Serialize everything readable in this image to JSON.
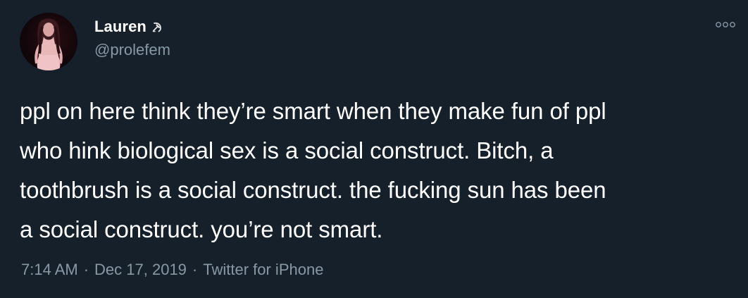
{
  "tweet": {
    "display_name": "Lauren",
    "handle": "@prolefem",
    "text": "ppl on here think they’re smart when they make fun of ppl\nwho hink biological sex is a social construct. Bitch, a\ntoothbrush is a social construct. the fucking sun has been\na social construct. you’re not smart.",
    "time": "7:14 AM",
    "separator": "·",
    "date": "Dec 17, 2019",
    "source": "Twitter for iPhone",
    "icons": {
      "name_emoji": "hammer-and-sickle-icon",
      "more": "more-options-icon"
    }
  },
  "colors": {
    "background": "#15202b",
    "primary_text": "#ffffff",
    "secondary_text": "#8899a6"
  }
}
